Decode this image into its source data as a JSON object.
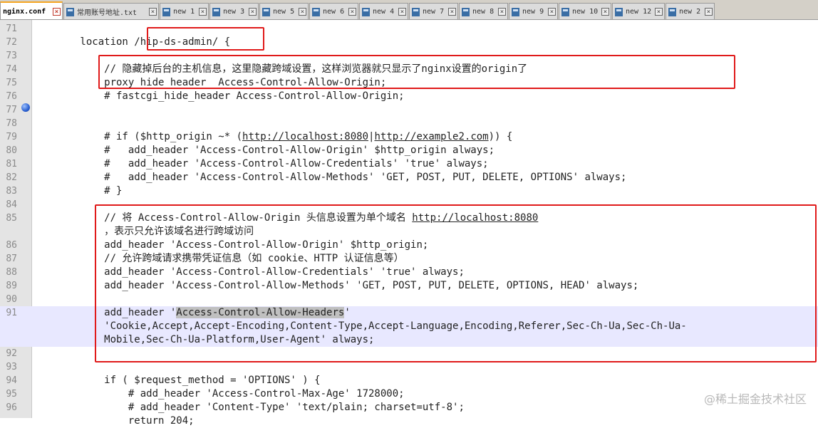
{
  "tabs": [
    {
      "label": "nginx.conf",
      "active": true
    },
    {
      "label": "常用账号地址.txt"
    },
    {
      "label": "new 1"
    },
    {
      "label": "new 3"
    },
    {
      "label": "new 5"
    },
    {
      "label": "new 6"
    },
    {
      "label": "new 4"
    },
    {
      "label": "new 7"
    },
    {
      "label": "new 8"
    },
    {
      "label": "new 9"
    },
    {
      "label": "new 10"
    },
    {
      "label": "new 12"
    },
    {
      "label": "new 2"
    }
  ],
  "lines": [
    {
      "num": "71",
      "text": ""
    },
    {
      "num": "72",
      "text": "        location /hip-ds-admin/ {"
    },
    {
      "num": "73",
      "text": ""
    },
    {
      "num": "74",
      "text": "            // 隐藏掉后台的主机信息，这里隐藏跨域设置，这样浏览器就只显示了nginx设置的origin了"
    },
    {
      "num": "75",
      "text": "            proxy_hide_header  Access-Control-Allow-Origin;"
    },
    {
      "num": "76",
      "text": "            # fastcgi_hide_header Access-Control-Allow-Origin;"
    },
    {
      "num": "77",
      "text": ""
    },
    {
      "num": "78",
      "text": ""
    },
    {
      "num": "79",
      "text": "            # if ($http_origin ~* (http://localhost:8080|http://example2.com)) {"
    },
    {
      "num": "80",
      "text": "            #   add_header 'Access-Control-Allow-Origin' $http_origin always;"
    },
    {
      "num": "81",
      "text": "            #   add_header 'Access-Control-Allow-Credentials' 'true' always;"
    },
    {
      "num": "82",
      "text": "            #   add_header 'Access-Control-Allow-Methods' 'GET, POST, PUT, DELETE, OPTIONS' always;"
    },
    {
      "num": "83",
      "text": "            # }"
    },
    {
      "num": "84",
      "text": ""
    },
    {
      "num": "85",
      "text": "            // 将 Access-Control-Allow-Origin 头信息设置为单个域名 http://localhost:8080"
    },
    {
      "num": "",
      "text": "            ，表示只允许该域名进行跨域访问"
    },
    {
      "num": "86",
      "text": "            add_header 'Access-Control-Allow-Origin' $http_origin;"
    },
    {
      "num": "87",
      "text": "            // 允许跨域请求携带凭证信息（如 cookie、HTTP 认证信息等）"
    },
    {
      "num": "88",
      "text": "            add_header 'Access-Control-Allow-Credentials' 'true' always;"
    },
    {
      "num": "89",
      "text": "            add_header 'Access-Control-Allow-Methods' 'GET, POST, PUT, DELETE, OPTIONS, HEAD' always;"
    },
    {
      "num": "90",
      "text": ""
    },
    {
      "num": "91",
      "text": "            add_header 'Access-Control-Allow-Headers'"
    },
    {
      "num": "",
      "text": "            'Cookie,Accept,Accept-Encoding,Content-Type,Accept-Language,Encoding,Referer,Sec-Ch-Ua,Sec-Ch-Ua-"
    },
    {
      "num": "",
      "text": "            Mobile,Sec-Ch-Ua-Platform,User-Agent' always;"
    },
    {
      "num": "92",
      "text": ""
    },
    {
      "num": "93",
      "text": ""
    },
    {
      "num": "94",
      "text": "            if ( $request_method = 'OPTIONS' ) {"
    },
    {
      "num": "95",
      "text": "                # add_header 'Access-Control-Max-Age' 1728000;"
    },
    {
      "num": "96",
      "text": "                # add_header 'Content-Type' 'text/plain; charset=utf-8';"
    },
    {
      "num": "",
      "text": "                return 204;"
    }
  ],
  "watermark": "@稀土掘金技术社区",
  "colors": {
    "annotation_box": "#e01a1a",
    "current_line": "#e8e8ff",
    "gutter": "#e4e4e4"
  }
}
